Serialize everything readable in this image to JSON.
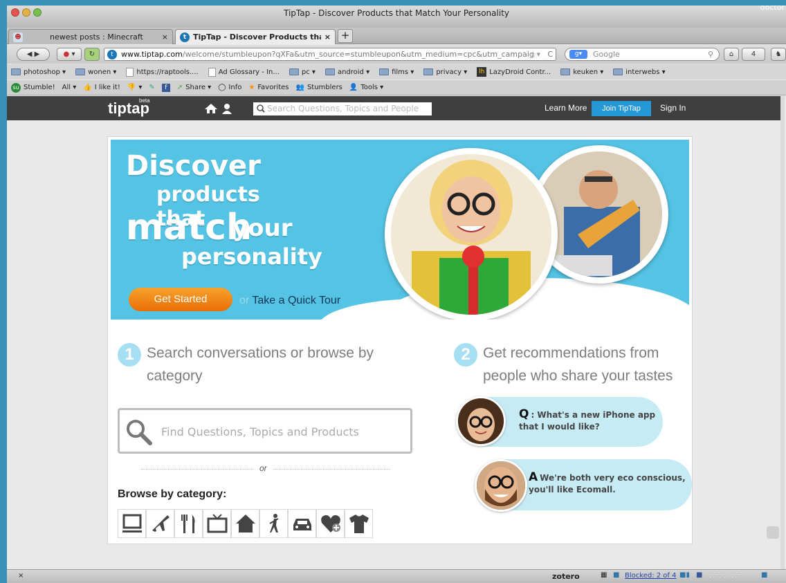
{
  "window": {
    "title": "TipTap - Discover Products that Match Your Personality",
    "corner_user": "doctor"
  },
  "tabs": [
    {
      "label": "newest posts : Minecraft",
      "close": "×"
    },
    {
      "label": "TipTap - Discover Products tha...",
      "close": "×"
    }
  ],
  "newtab": "+",
  "nav": {
    "url_host": "www.tiptap.com",
    "url_rest": "/welcome/stumbleupon?qXFa&utm_source=stumbleupon&utm_medium=cpc&utm_campaig",
    "search_engine": "Google",
    "notif_count": "4"
  },
  "bookmarks": [
    {
      "label": "photoshop ▾",
      "kind": "folder"
    },
    {
      "label": "wonen ▾",
      "kind": "folder"
    },
    {
      "label": "https://raptools....",
      "kind": "page"
    },
    {
      "label": "Ad Glossary - In...",
      "kind": "page"
    },
    {
      "label": "pc ▾",
      "kind": "folder"
    },
    {
      "label": "android ▾",
      "kind": "folder"
    },
    {
      "label": "films ▾",
      "kind": "folder"
    },
    {
      "label": "privacy ▾",
      "kind": "folder"
    },
    {
      "label": "LazyDroid Contr...",
      "kind": "lh"
    },
    {
      "label": "keuken ▾",
      "kind": "folder"
    },
    {
      "label": "interwebs ▾",
      "kind": "folder"
    }
  ],
  "stumble": {
    "items": [
      "Stumble!",
      "All ▾",
      "I like it!",
      "▾",
      "Share ▾",
      "Info",
      "Favorites",
      "Stumblers",
      "Tools ▾"
    ]
  },
  "site": {
    "logo": "tiptap",
    "logo_badge": "beta",
    "search_placeholder": "Search Questions, Topics and People",
    "learn_more": "Learn More",
    "join": "Join TipTap",
    "sign_in": "Sign In"
  },
  "hero": {
    "line1": "Discover",
    "line2": "products that",
    "line3a": "match",
    "line3b": "your",
    "line4": "personality",
    "cta": "Get Started",
    "or": "or",
    "tour": "Take a Quick Tour"
  },
  "steps": [
    {
      "num": "1",
      "text": "Search conversations or browse by category"
    },
    {
      "num": "2",
      "text": "Get recommendations from people who share your tastes"
    }
  ],
  "find": {
    "placeholder": "Find Questions, Topics and Products",
    "or": "or"
  },
  "browse": {
    "title": "Browse by category:",
    "categories": [
      "computer-icon",
      "airplane-icon",
      "fork-knife-icon",
      "tv-icon",
      "home-icon",
      "golf-icon",
      "car-icon",
      "heart-plus-icon",
      "tshirt-icon"
    ]
  },
  "qa": {
    "q_label": "Q",
    "q_text": ": What's a new iPhone app that I would like?",
    "a_label": "A",
    "a_text": "We're both very eco conscious, you'll like Ecomall."
  },
  "status": {
    "close": "×",
    "zotero": "zotero",
    "blocked": "Blocked: 2 of 4",
    "stars": "☆☆☆☆☆"
  }
}
